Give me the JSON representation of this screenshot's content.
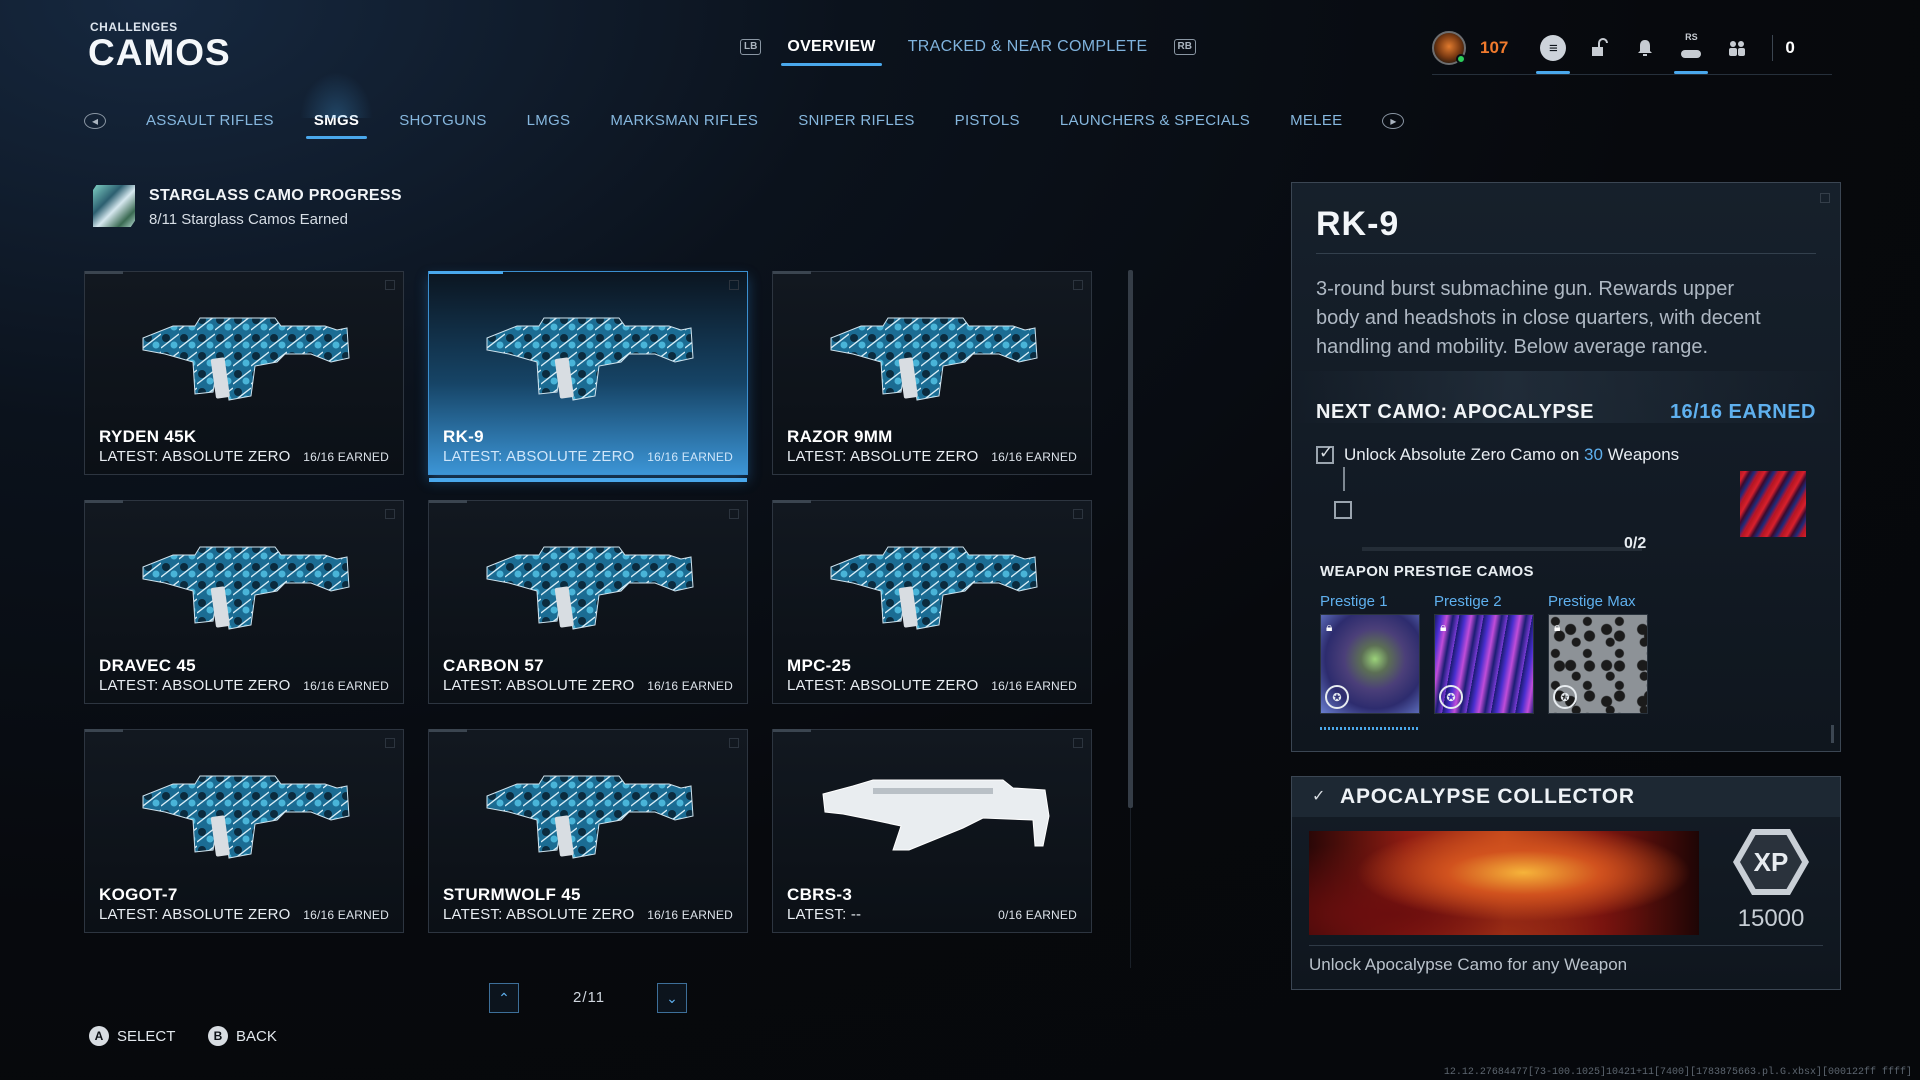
{
  "header": {
    "eyebrow": "CHALLENGES",
    "title": "CAMOS"
  },
  "top_tabs": {
    "left_bumper": "LB",
    "right_bumper": "RB",
    "items": [
      {
        "label": "OVERVIEW",
        "active": true
      },
      {
        "label": "TRACKED & NEAR COMPLETE",
        "active": false
      }
    ]
  },
  "status": {
    "rank_level": "107",
    "rs_label": "RS",
    "count": "0",
    "icons": [
      "rank-emblem",
      "menu-icon",
      "lock-icon",
      "bell-icon",
      "controller-icon",
      "social-icon"
    ]
  },
  "categories": {
    "items": [
      {
        "label": "ASSAULT RIFLES",
        "active": false
      },
      {
        "label": "SMGS",
        "active": true
      },
      {
        "label": "SHOTGUNS",
        "active": false
      },
      {
        "label": "LMGS",
        "active": false
      },
      {
        "label": "MARKSMAN RIFLES",
        "active": false
      },
      {
        "label": "SNIPER RIFLES",
        "active": false
      },
      {
        "label": "PISTOLS",
        "active": false
      },
      {
        "label": "LAUNCHERS & SPECIALS",
        "active": false
      },
      {
        "label": "MELEE",
        "active": false
      }
    ]
  },
  "progress": {
    "title": "STARGLASS CAMO PROGRESS",
    "subtitle": "8/11 Starglass Camos Earned"
  },
  "weapons": [
    {
      "name": "RYDEN 45K",
      "latest": "LATEST: ABSOLUTE ZERO",
      "earned": "16/16 EARNED",
      "selected": false,
      "camo": "blue"
    },
    {
      "name": "RK-9",
      "latest": "LATEST: ABSOLUTE ZERO",
      "earned": "16/16 EARNED",
      "selected": true,
      "camo": "blue"
    },
    {
      "name": "RAZOR 9MM",
      "latest": "LATEST: ABSOLUTE ZERO",
      "earned": "16/16 EARNED",
      "selected": false,
      "camo": "blue"
    },
    {
      "name": "DRAVEC 45",
      "latest": "LATEST: ABSOLUTE ZERO",
      "earned": "16/16 EARNED",
      "selected": false,
      "camo": "blue"
    },
    {
      "name": "CARBON 57",
      "latest": "LATEST: ABSOLUTE ZERO",
      "earned": "16/16 EARNED",
      "selected": false,
      "camo": "blue"
    },
    {
      "name": "MPC-25",
      "latest": "LATEST: ABSOLUTE ZERO",
      "earned": "16/16 EARNED",
      "selected": false,
      "camo": "blue"
    },
    {
      "name": "KOGOT-7",
      "latest": "LATEST: ABSOLUTE ZERO",
      "earned": "16/16 EARNED",
      "selected": false,
      "camo": "blue"
    },
    {
      "name": "STURMWOLF 45",
      "latest": "LATEST: ABSOLUTE ZERO",
      "earned": "16/16 EARNED",
      "selected": false,
      "camo": "blue"
    },
    {
      "name": "CBRS-3",
      "latest": "LATEST: --",
      "earned": "0/16 EARNED",
      "selected": false,
      "camo": "white"
    }
  ],
  "pagination": {
    "indicator": "2/11"
  },
  "controls": {
    "select_key": "A",
    "select_label": "SELECT",
    "back_key": "B",
    "back_label": "BACK"
  },
  "build_string": "12.12.27684477[73-100.1025]10421+11[7400][1783875663.pl.G.xbsx][000122ff ffff]",
  "detail": {
    "title": "RK-9",
    "description": "3-round burst submachine gun. Rewards upper body and headshots in close quarters, with decent handling and mobility. Below average range.",
    "next_camo_label": "NEXT CAMO: APOCALYPSE",
    "next_camo_earned": "16/16 EARNED",
    "challenge_prefix": "Unlock Absolute Zero Camo on ",
    "challenge_count": "30",
    "challenge_suffix": " Weapons",
    "challenge_progress": "0/2",
    "prestige_label": "WEAPON PRESTIGE CAMOS",
    "prestige": [
      {
        "name": "Prestige 1",
        "locked": true
      },
      {
        "name": "Prestige 2",
        "locked": true
      },
      {
        "name": "Prestige Max",
        "locked": true
      }
    ]
  },
  "collector": {
    "title": "APOCALYPSE COLLECTOR",
    "xp_label": "XP",
    "xp_value": "15000",
    "description": "Unlock Apocalypse Camo for any Weapon"
  },
  "colors": {
    "accent": "#4aa8ec",
    "link": "#5fb0ee",
    "rank": "#f07a2d"
  }
}
